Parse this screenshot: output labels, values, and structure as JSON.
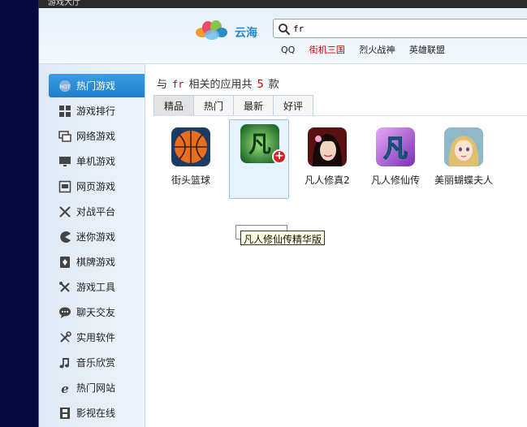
{
  "window": {
    "title": "游戏大厅"
  },
  "header": {
    "logo_text": "云海",
    "search": {
      "value": "fr",
      "placeholder": ""
    },
    "hotwords": [
      {
        "label": "QQ",
        "hot": false
      },
      {
        "label": "街机三国",
        "hot": true
      },
      {
        "label": "烈火战神",
        "hot": false
      },
      {
        "label": "英雄联盟",
        "hot": false
      }
    ]
  },
  "sidebar": {
    "items": [
      {
        "label": "热门游戏",
        "icon": "hot-icon",
        "active": true
      },
      {
        "label": "游戏排行",
        "icon": "ranking-icon"
      },
      {
        "label": "网络游戏",
        "icon": "network-game-icon"
      },
      {
        "label": "单机游戏",
        "icon": "monitor-icon"
      },
      {
        "label": "网页游戏",
        "icon": "webpage-icon"
      },
      {
        "label": "对战平台",
        "icon": "crossed-swords-icon"
      },
      {
        "label": "迷你游戏",
        "icon": "pacman-icon"
      },
      {
        "label": "棋牌游戏",
        "icon": "cards-icon"
      },
      {
        "label": "游戏工具",
        "icon": "tools-icon"
      },
      {
        "label": "聊天交友",
        "icon": "chat-icon"
      },
      {
        "label": "实用软件",
        "icon": "utility-icon"
      },
      {
        "label": "音乐欣赏",
        "icon": "music-icon"
      },
      {
        "label": "热门网站",
        "icon": "ie-icon"
      },
      {
        "label": "影视在线",
        "icon": "film-icon"
      }
    ]
  },
  "results": {
    "prefix": "与",
    "keyword": "fr",
    "middle": "相关的应用共",
    "count": "5",
    "suffix": "款"
  },
  "tabs": [
    {
      "label": "精品",
      "active": true
    },
    {
      "label": "热门",
      "active": false
    },
    {
      "label": "最新",
      "active": false
    },
    {
      "label": "好评",
      "active": false
    }
  ],
  "apps": [
    {
      "name": "街头篮球",
      "icon": "basketball-icon"
    },
    {
      "name": "",
      "icon": "fanren-green-icon",
      "selected": true
    },
    {
      "name": "凡人修真2",
      "icon": "fanren2-portrait-icon"
    },
    {
      "name": "凡人修仙传",
      "icon": "fanren-purple-icon"
    },
    {
      "name": "美丽蝴蝶夫人",
      "icon": "butterfly-lady-icon"
    }
  ],
  "tooltip": {
    "text": "凡人修仙传精华版"
  },
  "colors": {
    "accent": "#1f7fcf",
    "hotword_red": "#cc0000",
    "badge_red": "#d42020"
  }
}
